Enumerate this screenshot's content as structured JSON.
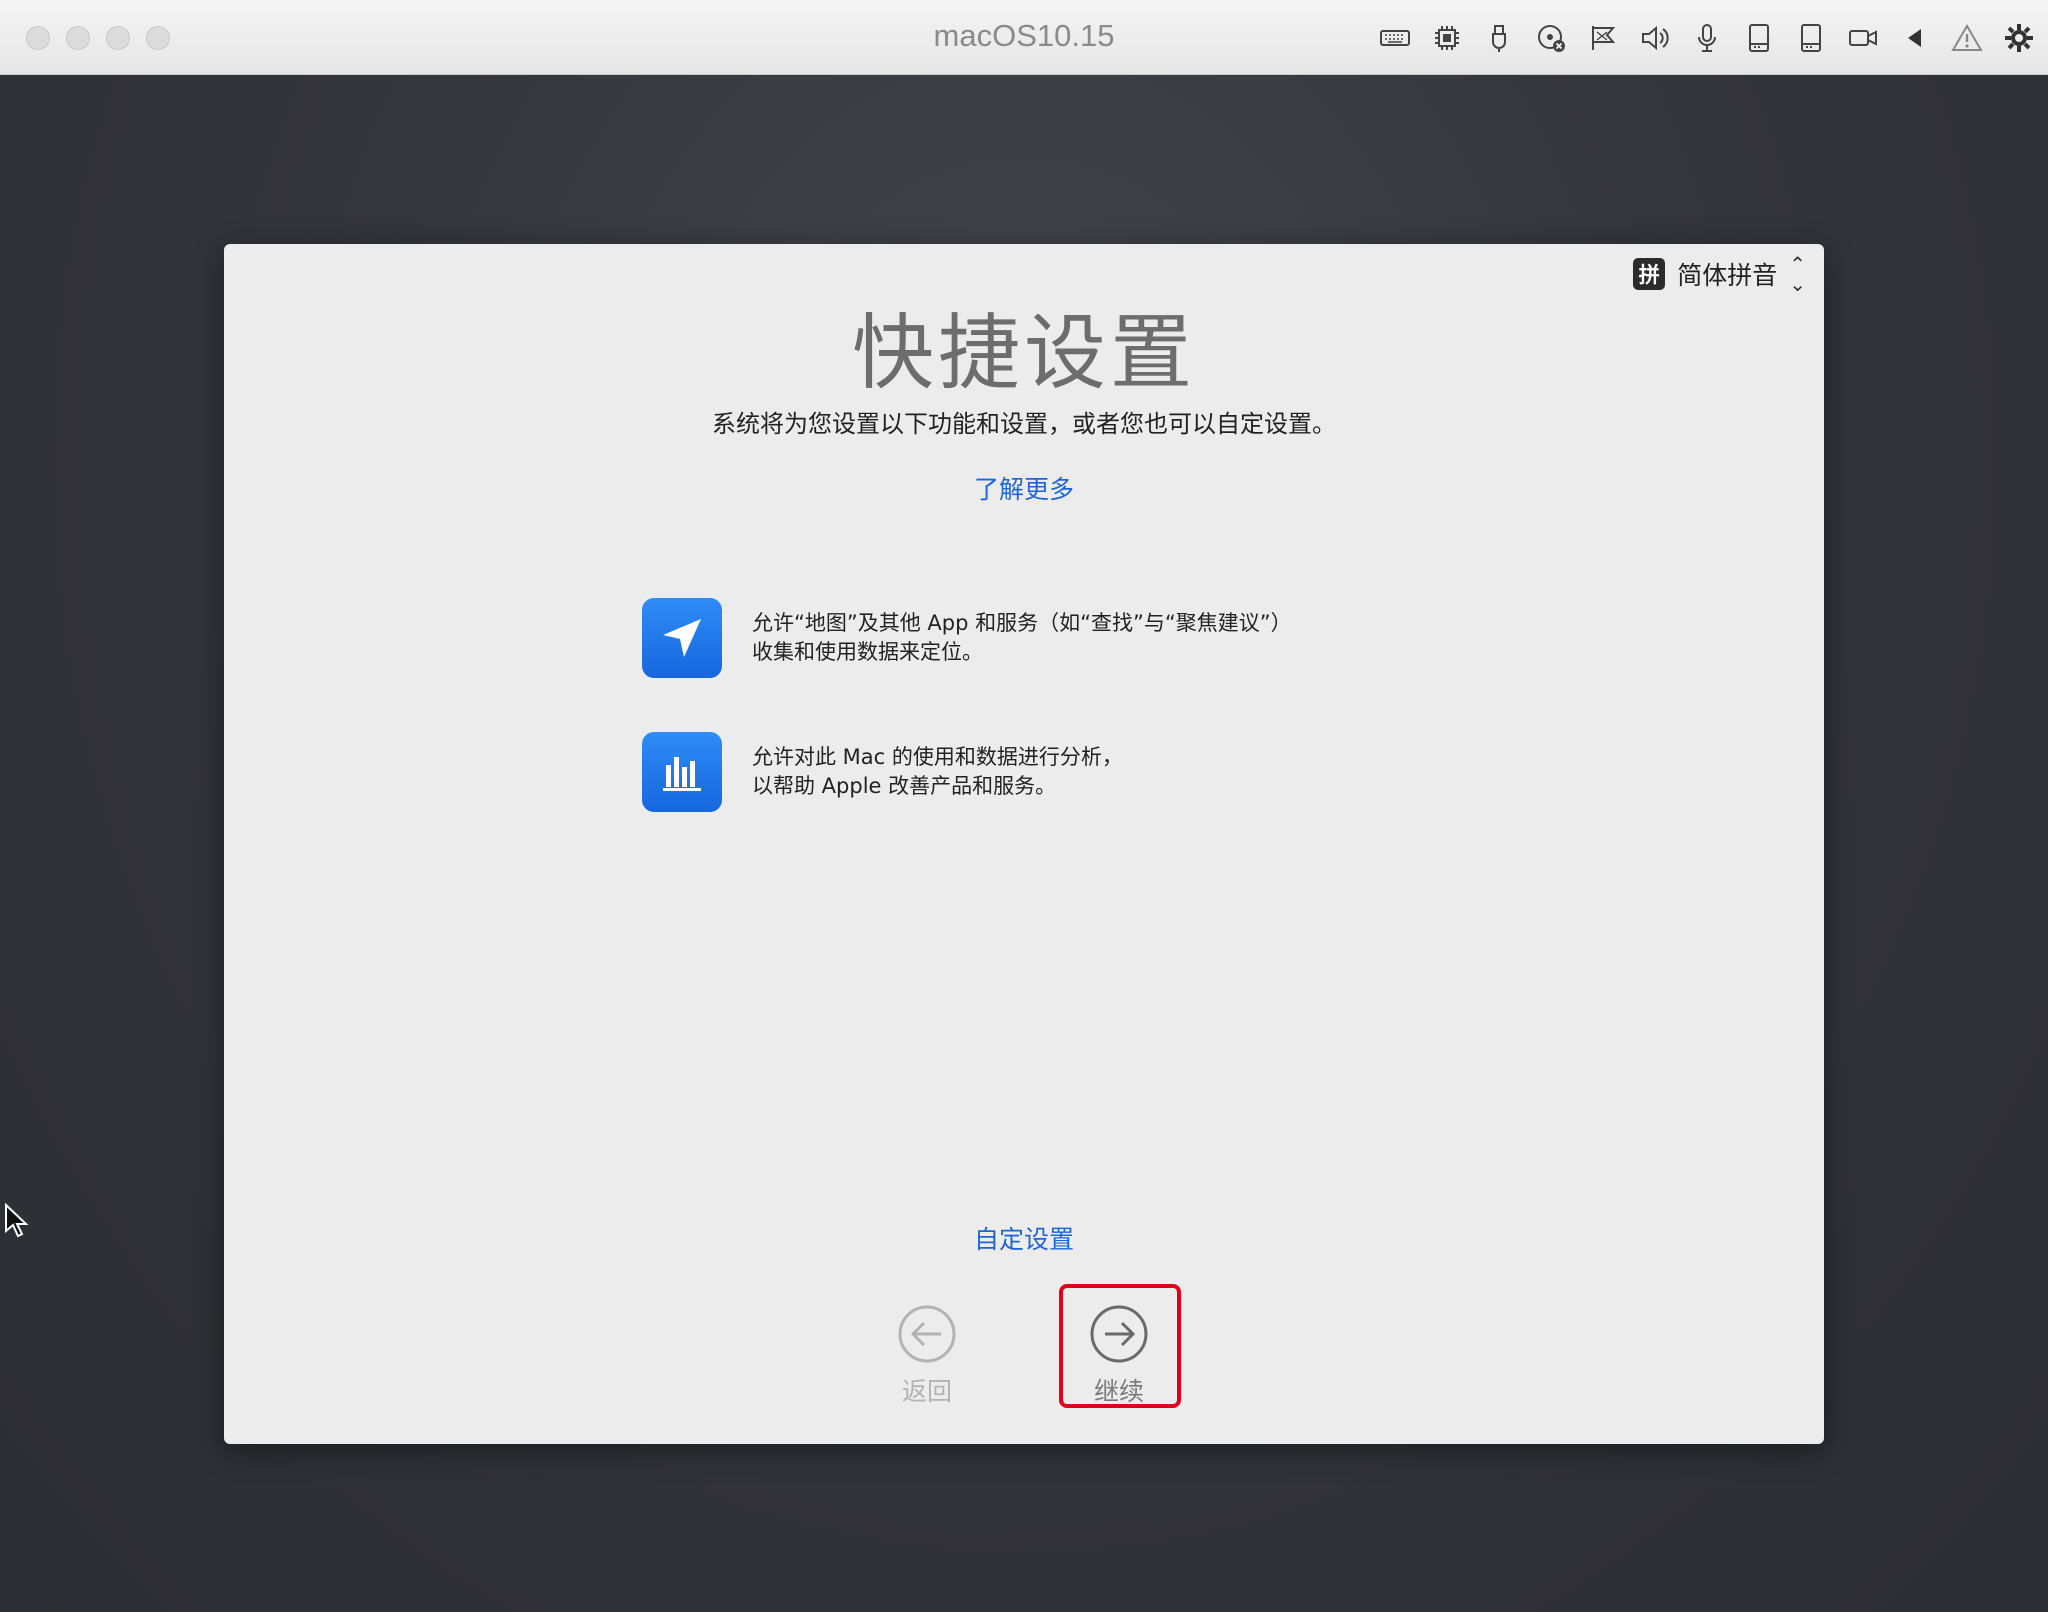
{
  "window": {
    "title": "macOS10.15"
  },
  "toolbar_icons": [
    "keyboard-icon",
    "cpu-icon",
    "usb-icon",
    "disc-icon",
    "network-icon",
    "speaker-icon",
    "microphone-icon",
    "hard-drive-icon",
    "hard-drive-2-icon",
    "camera-icon",
    "back-triangle-icon",
    "warning-icon",
    "gear-icon"
  ],
  "panel": {
    "input_method": {
      "badge": "拼",
      "label": "简体拼音"
    },
    "title": "快捷设置",
    "subtitle": "系统将为您设置以下功能和设置，或者您也可以自定设置。",
    "learn_more": "了解更多",
    "features": [
      {
        "icon": "location-arrow-icon",
        "line1": "允许“地图”及其他 App 和服务（如“查找”与“聚焦建议”）",
        "line2": "收集和使用数据来定位。"
      },
      {
        "icon": "analytics-chart-icon",
        "line1": "允许对此 Mac 的使用和数据进行分析，",
        "line2": "以帮助 Apple 改善产品和服务。"
      }
    ],
    "customize": "自定设置",
    "back_label": "返回",
    "continue_label": "继续"
  },
  "colors": {
    "accent": "#1e66d8",
    "highlight": "#e0001b",
    "icon_blue": "#1a73e8"
  }
}
